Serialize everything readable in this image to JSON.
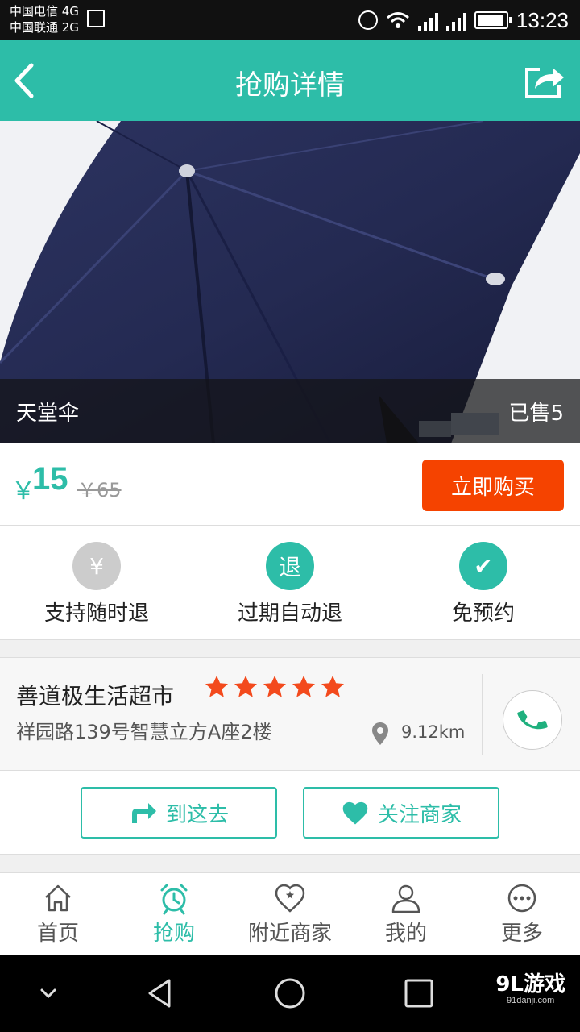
{
  "status_bar": {
    "carrier_1": "中国电信 4G",
    "carrier_2": "中国联通 2G",
    "network_tag_1": "4G",
    "network_tag_2": "2G",
    "time": "13:23"
  },
  "header": {
    "title": "抢购详情",
    "back_icon": "chevron-left-icon",
    "share_icon": "share-icon"
  },
  "product": {
    "name": "天堂伞",
    "sold": "已售5",
    "currency": "￥",
    "price": "15",
    "original_price": "￥65",
    "buy_label": "立即购买"
  },
  "features": [
    {
      "icon_text": "¥",
      "label": "支持随时退",
      "color": "#cccccc"
    },
    {
      "icon_text": "退",
      "label": "过期自动退",
      "color": "#2dbda8"
    },
    {
      "icon_text": "✔",
      "label": "免预约",
      "color": "#2dbda8"
    }
  ],
  "merchant": {
    "name": "善道极生活超市",
    "rating": 5,
    "address": "祥园路139号智慧立方A座2楼",
    "distance": "9.12km"
  },
  "actions": {
    "go_label": "到这去",
    "follow_label": "关注商家"
  },
  "tabs": [
    {
      "label": "首页",
      "icon": "home-icon",
      "active": false
    },
    {
      "label": "抢购",
      "icon": "alarm-clock-icon",
      "active": true
    },
    {
      "label": "附近商家",
      "icon": "heart-star-icon",
      "active": false
    },
    {
      "label": "我的",
      "icon": "user-icon",
      "active": false
    },
    {
      "label": "更多",
      "icon": "more-icon",
      "active": false
    }
  ],
  "watermark": {
    "main": "9L游戏",
    "sub": "91danji.com"
  },
  "colors": {
    "accent": "#2dbda8",
    "buy": "#f54300",
    "star": "#f34a1d"
  }
}
